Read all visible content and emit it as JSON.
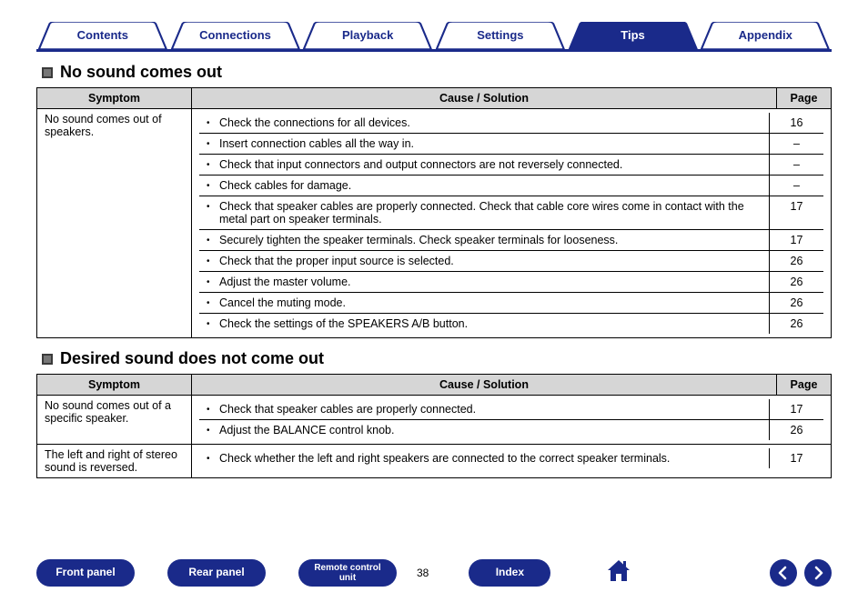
{
  "tabs": {
    "contents": "Contents",
    "connections": "Connections",
    "playback": "Playback",
    "settings": "Settings",
    "tips": "Tips",
    "appendix": "Appendix"
  },
  "section1": {
    "title": "No sound comes out",
    "headers": {
      "symptom": "Symptom",
      "cause": "Cause / Solution",
      "page": "Page"
    },
    "symptom": "No sound comes out of speakers.",
    "rows": [
      {
        "cause": "Check the connections for all devices.",
        "page": "16"
      },
      {
        "cause": "Insert connection cables all the way in.",
        "page": "–"
      },
      {
        "cause": "Check that input connectors and output connectors are not reversely connected.",
        "page": "–"
      },
      {
        "cause": "Check cables for damage.",
        "page": "–"
      },
      {
        "cause": "Check that speaker cables are properly connected. Check that cable core wires come in contact with the metal part on speaker terminals.",
        "page": "17"
      },
      {
        "cause": "Securely tighten the speaker terminals. Check speaker terminals for looseness.",
        "page": "17"
      },
      {
        "cause": "Check that the proper input source is selected.",
        "page": "26"
      },
      {
        "cause": "Adjust the master volume.",
        "page": "26"
      },
      {
        "cause": "Cancel the muting mode.",
        "page": "26"
      },
      {
        "cause": "Check the settings of the SPEAKERS A/B button.",
        "page": "26"
      }
    ]
  },
  "section2": {
    "title": "Desired sound does not come out",
    "headers": {
      "symptom": "Symptom",
      "cause": "Cause / Solution",
      "page": "Page"
    },
    "group1": {
      "symptom": "No sound comes out of a specific speaker.",
      "rows": [
        {
          "cause": "Check that speaker cables are properly connected.",
          "page": "17"
        },
        {
          "cause": "Adjust the BALANCE control knob.",
          "page": "26"
        }
      ]
    },
    "group2": {
      "symptom": "The left and right of stereo sound is reversed.",
      "rows": [
        {
          "cause": "Check whether the left and right speakers are connected to the correct speaker terminals.",
          "page": "17"
        }
      ]
    }
  },
  "footer": {
    "front_panel": "Front panel",
    "rear_panel": "Rear panel",
    "remote": "Remote control unit",
    "page": "38",
    "index": "Index"
  }
}
